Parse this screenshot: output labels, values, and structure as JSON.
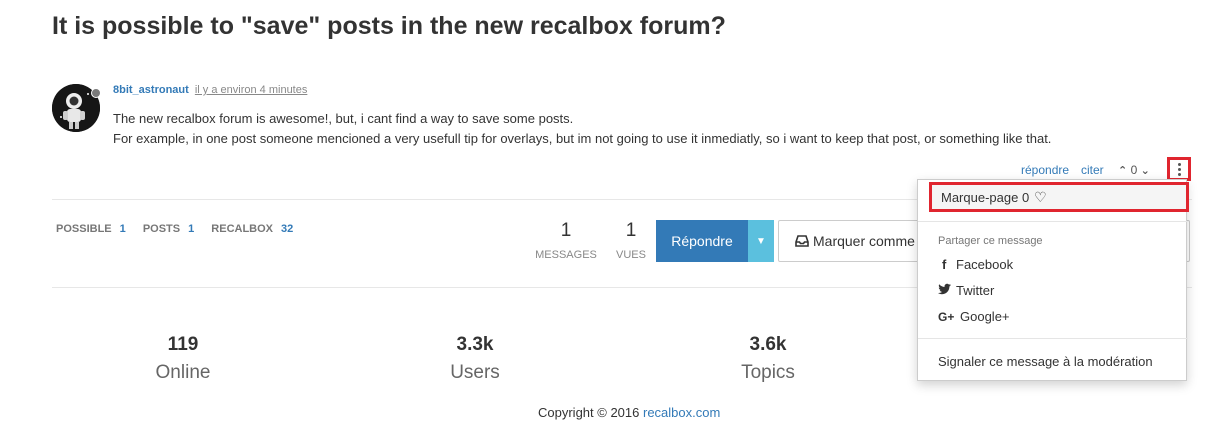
{
  "topic": {
    "title": "It is possible to \"save\" posts in the new recalbox forum?"
  },
  "post": {
    "username": "8bit_astronaut",
    "timestamp": "il y a environ 4 minutes",
    "lines": [
      "The new recalbox forum is awesome!, but, i cant find a way to save some posts.",
      "For example, in one post someone mencioned a very usefull tip for overlays, but im not going to use it inmediatly, so i want to keep that post, or something like that."
    ],
    "reply_label": "répondre",
    "quote_label": "citer",
    "votes": "0",
    "status_color": "#7a7a7a"
  },
  "tags": [
    {
      "name": "POSSIBLE",
      "count": "1"
    },
    {
      "name": "POSTS",
      "count": "1"
    },
    {
      "name": "RECALBOX",
      "count": "32"
    }
  ],
  "topic_stats": {
    "messages": {
      "value": "1",
      "label": "MESSAGES"
    },
    "views": {
      "value": "1",
      "label": "VUES"
    }
  },
  "actions": {
    "reply": "Répondre",
    "mark_unread": "Marquer comme non lu"
  },
  "forum_stats": [
    {
      "value": "119",
      "label": "Online"
    },
    {
      "value": "3.3k",
      "label": "Users"
    },
    {
      "value": "3.6k",
      "label": "Topics"
    }
  ],
  "footer": {
    "copyright": "Copyright © 2016",
    "link": "recalbox.com"
  },
  "dropdown": {
    "bookmark": "Marque-page 0",
    "share_header": "Partager ce message",
    "share": {
      "facebook": "Facebook",
      "twitter": "Twitter",
      "google": "Google+"
    },
    "flag": "Signaler ce message à la modération"
  },
  "colors": {
    "accent": "#337ab7",
    "accent_light": "#5bc0de",
    "highlight": "#e0252f"
  },
  "icons": [
    "more-vert-icon",
    "heart-icon",
    "facebook-icon",
    "twitter-icon",
    "google-plus-icon",
    "inbox-icon",
    "chevron-up-icon",
    "chevron-down-icon",
    "caret-down-icon"
  ]
}
